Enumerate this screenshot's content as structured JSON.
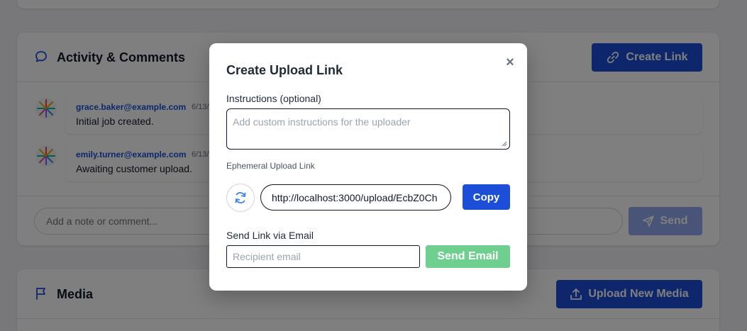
{
  "activity": {
    "title": "Activity & Comments",
    "create_link_label": "Create Link",
    "comments": [
      {
        "author": "grace.baker@example.com",
        "date": "6/13/",
        "text": "Initial job created."
      },
      {
        "author": "emily.turner@example.com",
        "date": "6/13/",
        "text": "Awaiting customer upload."
      }
    ],
    "comment_placeholder": "Add a note or comment...",
    "send_label": "Send"
  },
  "media": {
    "title": "Media",
    "upload_label": "Upload New Media"
  },
  "modal": {
    "title": "Create Upload Link",
    "close_symbol": "×",
    "instructions_label": "Instructions (optional)",
    "instructions_placeholder": "Add custom instructions for the uploader",
    "ephemeral_label": "Ephemeral Upload Link",
    "link_value": "http://localhost:3000/upload/EcbZ0Ch",
    "copy_label": "Copy",
    "email_label": "Send Link via Email",
    "email_placeholder": "Recipient email",
    "send_email_label": "Send Email"
  },
  "colors": {
    "primary": "#1d4ed8",
    "success": "#6fcf8f",
    "overlay": "rgba(0,0,0,0.5)"
  },
  "icons": [
    "comment-icon",
    "link-icon",
    "flag-icon",
    "upload-icon",
    "send-icon",
    "refresh-icon",
    "close-icon",
    "pinwheel-avatar-icon"
  ]
}
